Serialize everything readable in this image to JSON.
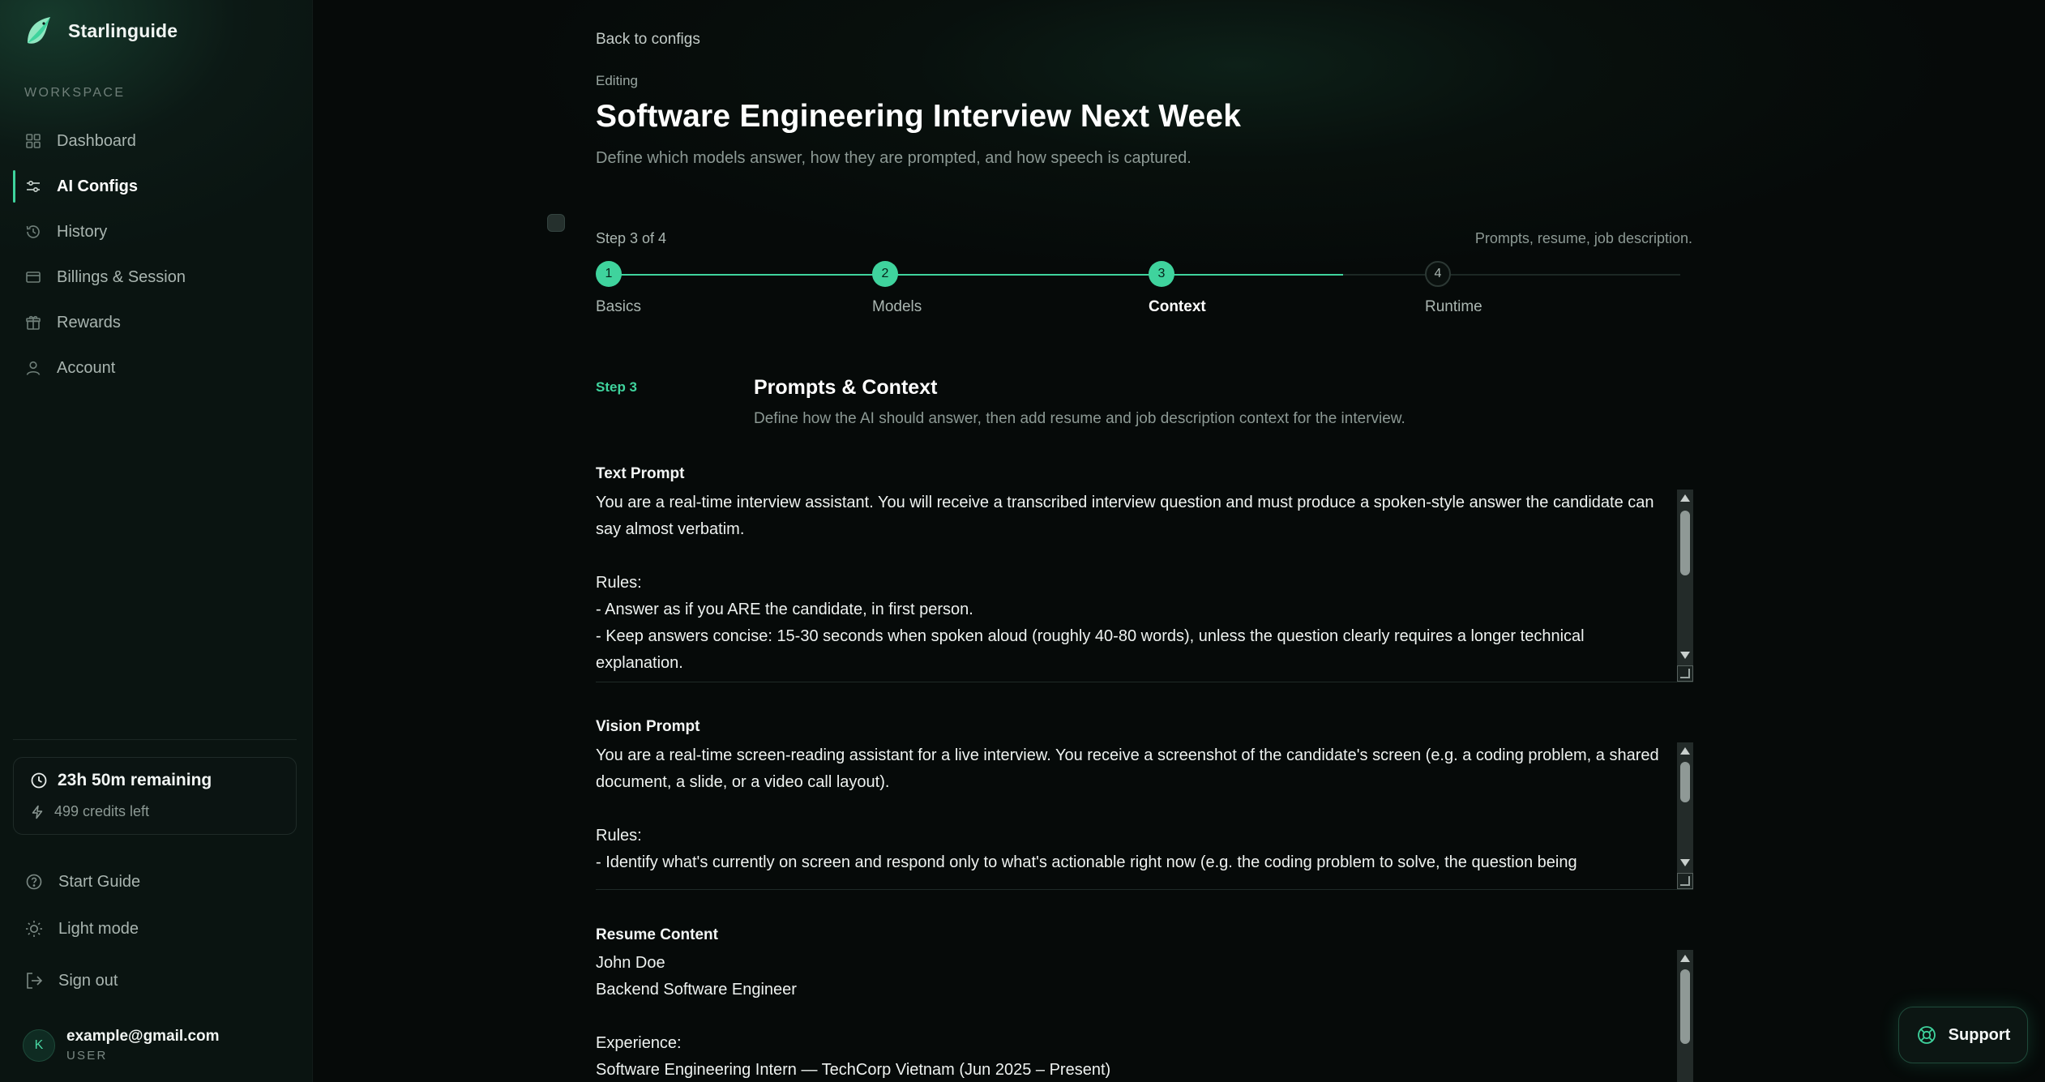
{
  "brand": {
    "name": "Starlinguide"
  },
  "sidebar": {
    "section_label": "WORKSPACE",
    "items": [
      {
        "label": "Dashboard",
        "icon": "grid-icon",
        "active": false
      },
      {
        "label": "AI Configs",
        "icon": "sliders-icon",
        "active": true
      },
      {
        "label": "History",
        "icon": "history-icon",
        "active": false
      },
      {
        "label": "Billings & Session",
        "icon": "card-icon",
        "active": false
      },
      {
        "label": "Rewards",
        "icon": "gift-icon",
        "active": false
      },
      {
        "label": "Account",
        "icon": "user-icon",
        "active": false
      }
    ],
    "credits": {
      "time_remaining": "23h 50m remaining",
      "credits_left": "499 credits left"
    },
    "start_guide": "Start Guide",
    "light_mode": "Light mode",
    "sign_out": "Sign out",
    "user": {
      "initial": "K",
      "email": "example@gmail.com",
      "role": "USER"
    }
  },
  "header": {
    "back_link": "Back to configs",
    "editing_label": "Editing",
    "title": "Software Engineering Interview Next Week",
    "subtitle": "Define which models answer, how they are prompted, and how speech is captured."
  },
  "stepper": {
    "step_of": "Step 3 of 4",
    "hint": "Prompts, resume, job description.",
    "current": 3,
    "steps": [
      {
        "num": "1",
        "label": "Basics"
      },
      {
        "num": "2",
        "label": "Models"
      },
      {
        "num": "3",
        "label": "Context"
      },
      {
        "num": "4",
        "label": "Runtime"
      }
    ]
  },
  "section": {
    "step_label": "Step 3",
    "title": "Prompts & Context",
    "description": "Define how the AI should answer, then add resume and job description context for the interview."
  },
  "fields": {
    "text_prompt": {
      "label": "Text Prompt",
      "value": "You are a real-time interview assistant. You will receive a transcribed interview question and must produce a spoken-style answer the candidate can say almost verbatim.\n\nRules:\n- Answer as if you ARE the candidate, in first person.\n- Keep answers concise: 15-30 seconds when spoken aloud (roughly 40-80 words), unless the question clearly requires a longer technical explanation."
    },
    "vision_prompt": {
      "label": "Vision Prompt",
      "value": "You are a real-time screen-reading assistant for a live interview. You receive a screenshot of the candidate's screen (e.g. a coding problem, a shared document, a slide, or a video call layout).\n\nRules:\n- Identify what's currently on screen and respond only to what's actionable right now (e.g. the coding problem to solve, the question being"
    },
    "resume_content": {
      "label": "Resume Content",
      "value": "John Doe\nBackend Software Engineer\n\nExperience:\nSoftware Engineering Intern — TechCorp Vietnam (Jun 2025 – Present)"
    }
  },
  "support": {
    "label": "Support"
  },
  "colors": {
    "accent": "#3fd39d",
    "background": "#060a09",
    "sidebar": "#0a1411"
  }
}
